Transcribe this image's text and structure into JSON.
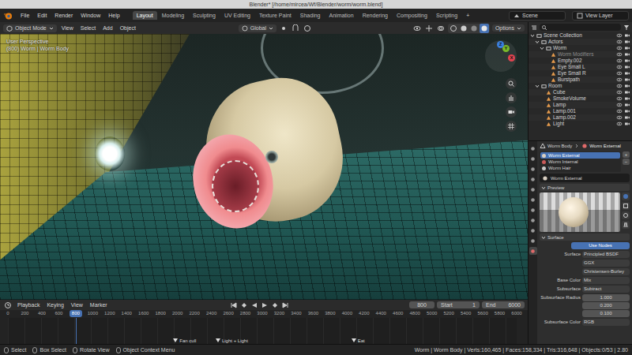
{
  "window": {
    "title": "Blender* [/home/mircea/Wf/Blender/worm/worm.blend]"
  },
  "menus": [
    "File",
    "Edit",
    "Render",
    "Window",
    "Help"
  ],
  "workspaces": [
    {
      "label": "Layout",
      "selected": true
    },
    {
      "label": "Modeling",
      "selected": false
    },
    {
      "label": "Sculpting",
      "selected": false
    },
    {
      "label": "UV Editing",
      "selected": false
    },
    {
      "label": "Texture Paint",
      "selected": false
    },
    {
      "label": "Shading",
      "selected": false
    },
    {
      "label": "Animation",
      "selected": false
    },
    {
      "label": "Rendering",
      "selected": false
    },
    {
      "label": "Compositing",
      "selected": false
    },
    {
      "label": "Scripting",
      "selected": false
    }
  ],
  "add_workspace": "+",
  "scene": "Scene",
  "view_layer": "View Layer",
  "viewport": {
    "mode": "Object Mode",
    "menus": [
      "View",
      "Select",
      "Add",
      "Object"
    ],
    "orientation": "Global",
    "options": "Options",
    "perspective": "User Perspective",
    "context": "(800) Worm | Worm Body",
    "axes": [
      {
        "label": "X",
        "color": "#e0434f"
      },
      {
        "label": "Y",
        "color": "#7ab92a"
      },
      {
        "label": "Z",
        "color": "#3b7fe0"
      }
    ]
  },
  "outliner": {
    "items": [
      {
        "label": "Scene Collection",
        "expanded": true,
        "dimmed": false,
        "children": [
          {
            "label": "Actors",
            "expanded": true,
            "dimmed": false,
            "children": [
              {
                "label": "Worm",
                "expanded": true,
                "dimmed": false,
                "children": [
                  {
                    "label": "Worm Modifiers",
                    "dimmed": true
                  },
                  {
                    "label": "Empty.002",
                    "dimmed": false
                  },
                  {
                    "label": "Eye Small L",
                    "dimmed": false
                  },
                  {
                    "label": "Eye Small R",
                    "dimmed": false
                  },
                  {
                    "label": "Burstpath",
                    "dimmed": false
                  }
                ]
              }
            ]
          },
          {
            "label": "Room",
            "expanded": true,
            "dimmed": false,
            "children": [
              {
                "label": "Cube",
                "dimmed": false
              },
              {
                "label": "SmokeVolume",
                "dimmed": false
              },
              {
                "label": "Lamp",
                "dimmed": false
              },
              {
                "label": "Lamp.001",
                "dimmed": false
              },
              {
                "label": "Lamp.002",
                "dimmed": false
              },
              {
                "label": "Light",
                "dimmed": false
              }
            ]
          }
        ]
      }
    ]
  },
  "properties": {
    "breadcrumb": [
      "Worm Body",
      "Worm External"
    ],
    "tabs": [
      {
        "selected": false
      },
      {
        "selected": false
      },
      {
        "selected": false
      },
      {
        "selected": false
      },
      {
        "selected": false
      },
      {
        "selected": false
      },
      {
        "selected": false
      },
      {
        "selected": false
      },
      {
        "selected": false
      },
      {
        "selected": false
      },
      {
        "selected": true
      }
    ],
    "slots": [
      {
        "label": "Worm External",
        "selected": true,
        "color": "#d9cfc2"
      },
      {
        "label": "Worm Internal",
        "selected": false,
        "color": "#c85a5a"
      },
      {
        "label": "Worm Hair",
        "selected": false,
        "color": "#c9c9c9"
      }
    ],
    "slot_buttons": [
      "+",
      "−"
    ],
    "material": "Worm External",
    "preview_title": "Preview",
    "surface_title": "Surface",
    "use_nodes": "Use Nodes",
    "fields": [
      {
        "kind": "dropdown",
        "label": "Surface",
        "value": "Principled BSDF"
      },
      {
        "kind": "dropdown",
        "label": "",
        "value": "GGX"
      },
      {
        "kind": "dropdown",
        "label": "",
        "value": "Christensen-Burley"
      },
      {
        "kind": "dropdown",
        "label": "Base Color",
        "value": "Mix"
      },
      {
        "kind": "dropdown",
        "label": "Subsurface",
        "value": "Subtract"
      },
      {
        "kind": "vector",
        "label": "Subsurface Radius",
        "values": [
          "1.000",
          "0.200",
          "0.100"
        ]
      },
      {
        "kind": "dropdown",
        "label": "Subsurface Color",
        "value": "RGB"
      }
    ]
  },
  "timeline": {
    "menus": [
      "Playback",
      "Keying",
      "View",
      "Marker"
    ],
    "current": "800",
    "start_label": "Start",
    "start": "1",
    "end_label": "End",
    "end": "6000",
    "ticks": [
      "0",
      "200",
      "400",
      "600",
      "800",
      "1000",
      "1200",
      "1400",
      "1600",
      "1800",
      "2000",
      "2200",
      "2400",
      "2600",
      "2800",
      "3000",
      "3200",
      "3400",
      "3600",
      "3800",
      "4000",
      "4200",
      "4400",
      "4600",
      "4800",
      "5000",
      "5200",
      "5400",
      "5600",
      "5800",
      "6000"
    ],
    "markers": [
      {
        "label": "Fan cull",
        "frame": 1950
      },
      {
        "label": "Light + Light",
        "frame": 2450
      },
      {
        "label": "Eat",
        "frame": 4050
      }
    ]
  },
  "status_bar": {
    "hints": [
      "Select",
      "Box Select",
      "Rotate View",
      "Object Context Menu"
    ],
    "stats": "Worm | Worm Body | Verts:160,465 | Faces:158,334 | Tris:316,648 | Objects:0/53 | 2.80"
  }
}
